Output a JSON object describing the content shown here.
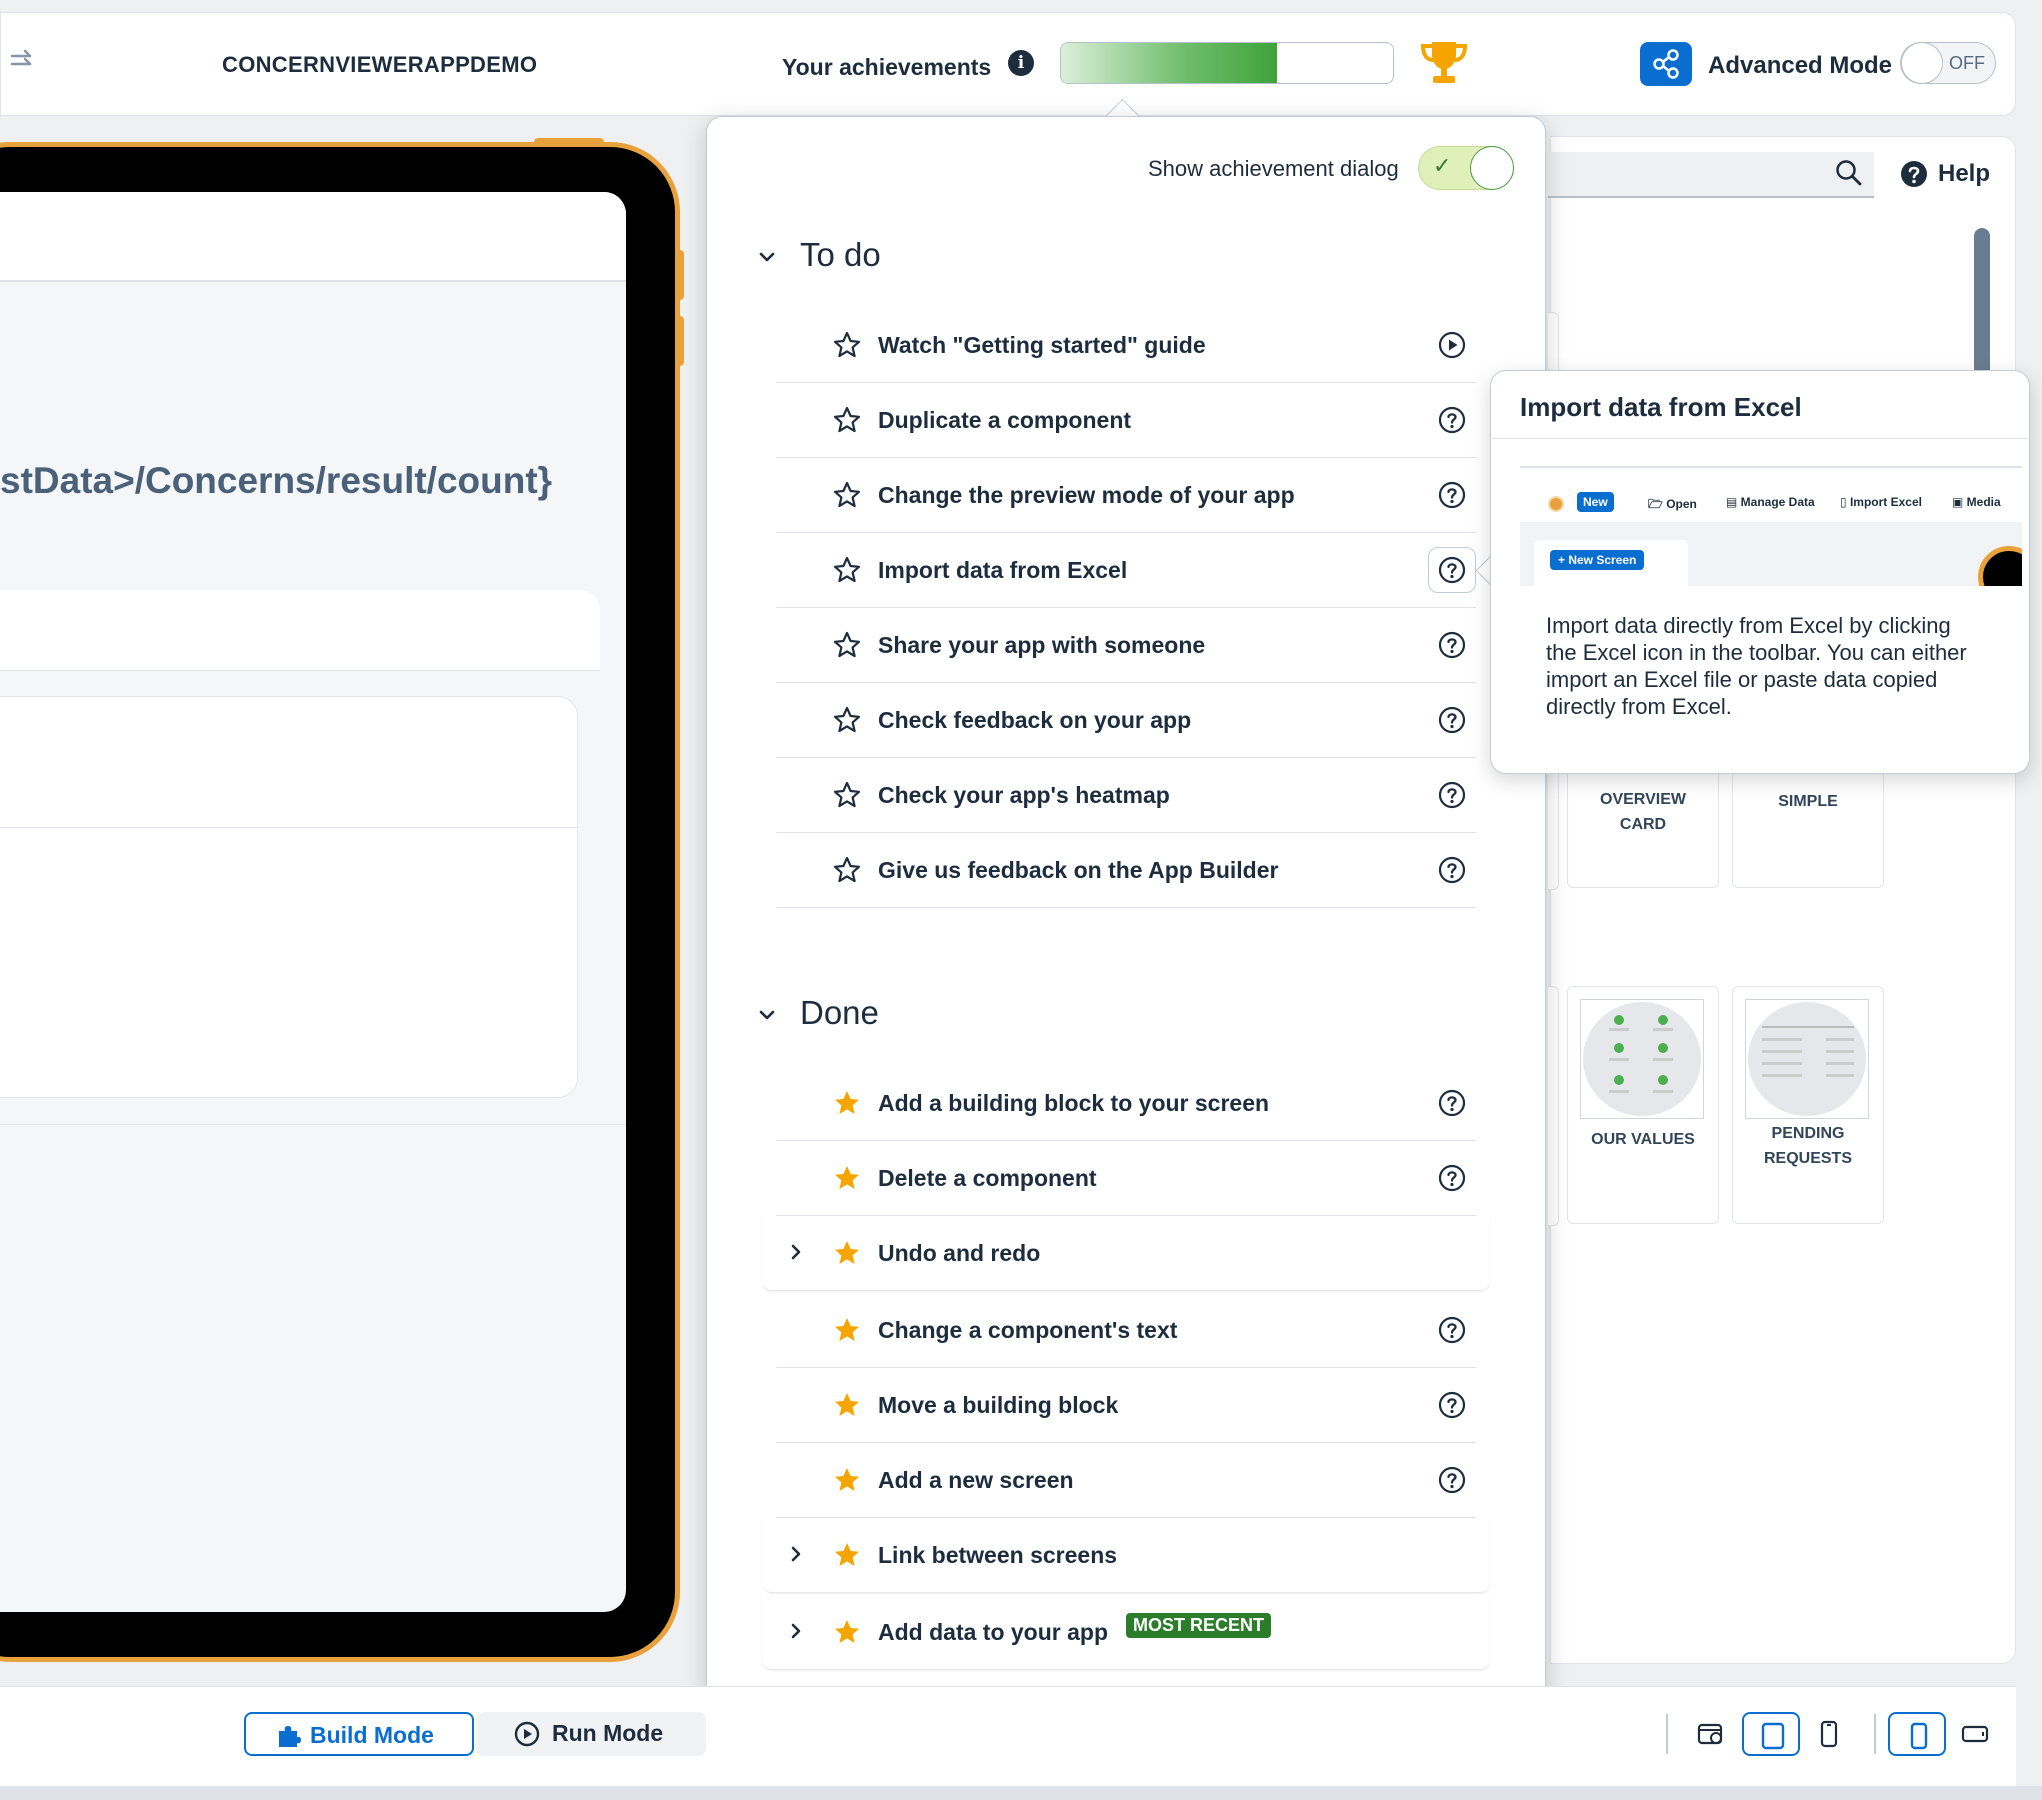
{
  "colors": {
    "accent": "#0a6ed1",
    "success": "#2b7c2b",
    "star_done": "#f5a400",
    "device_frame": "#e9a23b"
  },
  "header": {
    "app_title": "CONCERNVIEWERAPPDEMO",
    "achievements_label": "Your achievements",
    "progress_percent": 65,
    "progress_text": "65%",
    "advanced_mode_label": "Advanced Mode",
    "advanced_mode_state": "OFF",
    "icons": [
      "redo-icon",
      "info-icon",
      "trophy-icon",
      "share-icon"
    ]
  },
  "preview": {
    "binding_text": "stData>/Concerns/result/count}"
  },
  "right_panel": {
    "help_label": "Help",
    "tiles": [
      {
        "label_line1": "OVERVIEW",
        "label_line2": "CARD"
      },
      {
        "label_line1": "SIMPLE",
        "label_line2": ""
      },
      {
        "label_line1": "OUR VALUES",
        "label_line2": ""
      },
      {
        "label_line1": "PENDING",
        "label_line2": "REQUESTS"
      }
    ]
  },
  "achievements": {
    "show_dialog_label": "Show achievement dialog",
    "show_dialog_on": true,
    "todo": {
      "title": "To do",
      "items": [
        {
          "label": "Watch \"Getting started\" guide",
          "icon": "play-icon"
        },
        {
          "label": "Duplicate a component",
          "icon": "question-icon"
        },
        {
          "label": "Change the preview mode of your app",
          "icon": "question-icon"
        },
        {
          "label": "Import data from Excel",
          "icon": "question-icon",
          "selected": true
        },
        {
          "label": "Share your app with someone",
          "icon": "question-icon"
        },
        {
          "label": "Check feedback on your app",
          "icon": "question-icon"
        },
        {
          "label": "Check your app's heatmap",
          "icon": "question-icon"
        },
        {
          "label": "Give us feedback on the App Builder",
          "icon": "question-icon"
        }
      ]
    },
    "done": {
      "title": "Done",
      "items": [
        {
          "label": "Add a building block to your screen",
          "icon": "question-icon"
        },
        {
          "label": "Delete a component",
          "icon": "question-icon"
        },
        {
          "label": "Undo and redo",
          "expandable": true
        },
        {
          "label": "Change a component's text",
          "icon": "question-icon"
        },
        {
          "label": "Move a building block",
          "icon": "question-icon"
        },
        {
          "label": "Add a new screen",
          "icon": "question-icon"
        },
        {
          "label": "Link between screens",
          "expandable": true
        },
        {
          "label": "Add data to your app",
          "expandable": true,
          "badge": "MOST RECENT"
        }
      ]
    }
  },
  "tooltip": {
    "title": "Import data from Excel",
    "toolbar": {
      "new": "New",
      "open": "Open",
      "manage_data": "Manage Data",
      "import_excel": "Import Excel",
      "media": "Media",
      "new_screen": "+ New Screen"
    },
    "body": "Import data directly from Excel by clicking the Excel icon in the toolbar. You can either import an Excel file or paste data copied directly from Excel."
  },
  "bottom": {
    "build_mode_label": "Build Mode",
    "run_mode_label": "Run Mode",
    "device_icons": [
      "browser-icon",
      "tablet-icon",
      "phone-icon",
      "portrait-icon",
      "landscape-icon"
    ]
  }
}
